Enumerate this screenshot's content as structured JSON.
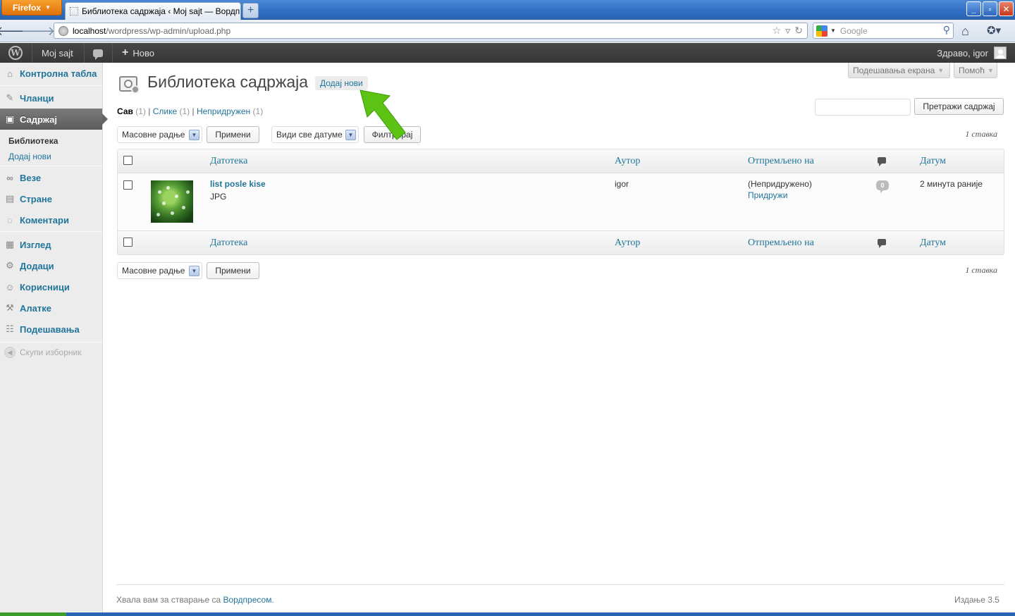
{
  "browser": {
    "menu_label": "Firefox",
    "tab_title": "Библиотека садржаја ‹ Moj sajt — Вордпрес",
    "new_tab": "+",
    "url_host": "localhost",
    "url_path": "/wordpress/wp-admin/upload.php",
    "search_placeholder": "Google",
    "win_min": "_",
    "win_max": "▫",
    "win_close": "✕"
  },
  "adminbar": {
    "site_name": "Moj sajt",
    "new_label": "Ново",
    "new_plus": "+",
    "greeting": "Здраво, igor",
    "wp_logo": "W"
  },
  "sidebar": {
    "items": [
      {
        "label": "Контролна табла",
        "icon": "dashboard-icon",
        "glyph": "⌂"
      },
      {
        "label": "Чланци",
        "icon": "pin-icon",
        "glyph": "✎"
      },
      {
        "label": "Садржај",
        "icon": "media-icon",
        "glyph": "▣"
      },
      {
        "label": "Везе",
        "icon": "link-icon",
        "glyph": "∞"
      },
      {
        "label": "Стране",
        "icon": "pages-icon",
        "glyph": "▤"
      },
      {
        "label": "Коментари",
        "icon": "comments-icon",
        "glyph": "◌"
      },
      {
        "label": "Изглед",
        "icon": "appearance-icon",
        "glyph": "▦"
      },
      {
        "label": "Додаци",
        "icon": "plugins-icon",
        "glyph": "⚙"
      },
      {
        "label": "Корисници",
        "icon": "users-icon",
        "glyph": "☺"
      },
      {
        "label": "Алатке",
        "icon": "tools-icon",
        "glyph": "⚒"
      },
      {
        "label": "Подешавања",
        "icon": "settings-icon",
        "glyph": "☷"
      }
    ],
    "submenu": [
      "Библиотека",
      "Додај нови"
    ],
    "collapse_label": "Скупи изборник",
    "collapse_glyph": "◀"
  },
  "top_tabs": {
    "screen_options": "Подешавања екрана",
    "help": "Помоћ",
    "arrow": "▼"
  },
  "page": {
    "title": "Библиотека садржаја",
    "add_new": "Додај нови"
  },
  "filters": {
    "all_label": "Сав",
    "all_count": "(1)",
    "images_label": "Слике",
    "images_count": "(1)",
    "unattached_label": "Непридружен",
    "unattached_count": "(1)",
    "sep": "|"
  },
  "search": {
    "button": "Претражи садржај",
    "value": ""
  },
  "tablenav": {
    "bulk_actions": "Масовне радње",
    "apply": "Примени",
    "dates": "Види све датуме",
    "filter": "Филтрирај",
    "items_count": "1 ставка",
    "dd": "▼"
  },
  "table": {
    "columns": {
      "file": "Датотека",
      "author": "Аутор",
      "uploaded_to": "Отпремљено на",
      "date": "Датум"
    },
    "rows": [
      {
        "title": "list posle kise",
        "ext": "JPG",
        "author": "igor",
        "uploaded_to": "(Непридружено)",
        "attach": "Придружи",
        "comments": "0",
        "date": "2 минута раније"
      }
    ]
  },
  "footer": {
    "thanks": "Хвала вам за стварање са ",
    "wp_link": "Вордпресом",
    "period": ".",
    "version": "Издање 3.5"
  },
  "colors": {
    "link": "#21759b",
    "admin_bar": "#464646",
    "annotation_arrow": "#5cc314"
  }
}
